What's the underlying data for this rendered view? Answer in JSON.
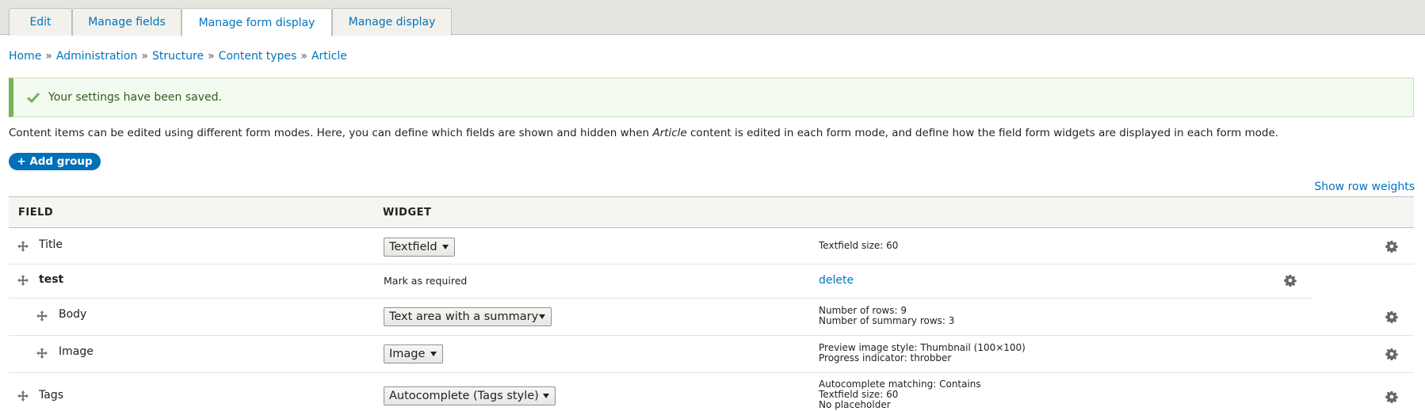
{
  "tabs": [
    {
      "label": "Edit"
    },
    {
      "label": "Manage fields"
    },
    {
      "label": "Manage form display"
    },
    {
      "label": "Manage display"
    }
  ],
  "breadcrumb": {
    "items": [
      "Home",
      "Administration",
      "Structure",
      "Content types",
      "Article"
    ],
    "separator": "»"
  },
  "message": {
    "text": "Your settings have been saved."
  },
  "description": {
    "before": "Content items can be edited using different form modes. Here, you can define which fields are shown and hidden when ",
    "emphasis": "Article",
    "after": " content is edited in each form mode, and define how the field form widgets are displayed in each form mode."
  },
  "actions": {
    "add_group": "+ Add group",
    "show_row_weights": "Show row weights"
  },
  "table": {
    "headers": {
      "field": "FIELD",
      "widget": "WIDGET"
    },
    "rows": [
      {
        "label": "Title",
        "widget": "Textfield",
        "summary": [
          "Textfield size: 60"
        ]
      },
      {
        "label": "test",
        "mark_required": "Mark as required",
        "delete": "delete"
      },
      {
        "label": "Body",
        "widget": "Text area with a summary",
        "summary": [
          "Number of rows: 9",
          "Number of summary rows: 3"
        ]
      },
      {
        "label": "Image",
        "widget": "Image",
        "summary": [
          "Preview image style: Thumbnail (100×100)",
          "Progress indicator: throbber"
        ]
      },
      {
        "label": "Tags",
        "widget": "Autocomplete (Tags style)",
        "summary": [
          "Autocomplete matching: Contains",
          "Textfield size: 60",
          "No placeholder"
        ]
      }
    ]
  },
  "icons": {
    "drag": "drag-handle-icon",
    "gear": "gear-icon",
    "check": "check-icon"
  },
  "colors": {
    "link": "#0074bd",
    "button": "#0071b8",
    "success_border": "#77b259"
  }
}
